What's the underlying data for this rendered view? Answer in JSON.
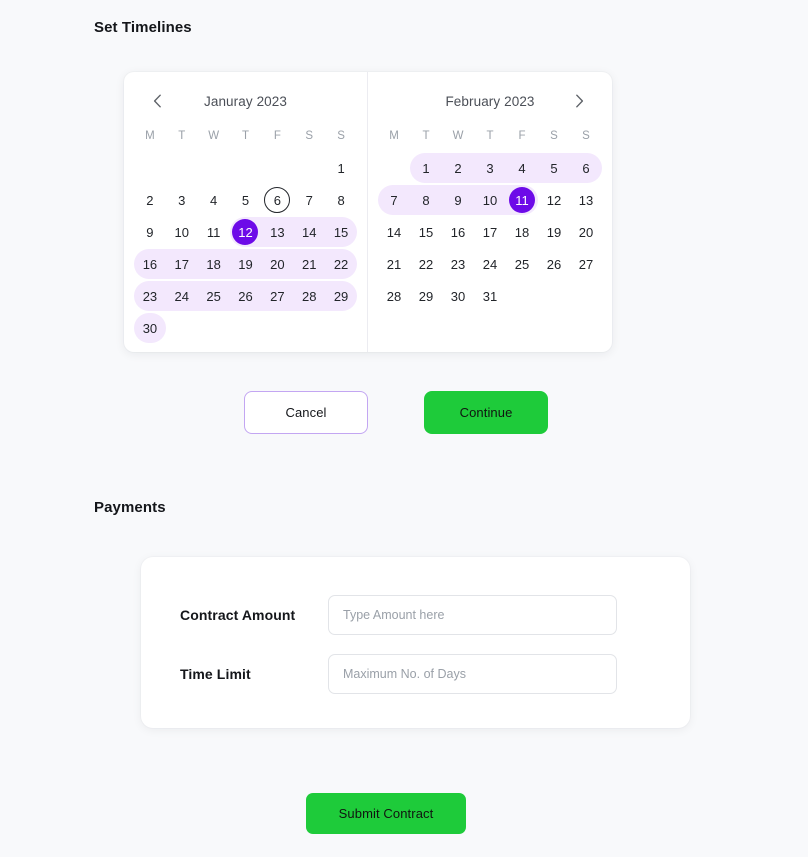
{
  "sections": {
    "timelines_title": "Set Timelines",
    "payments_title": "Payments"
  },
  "colors": {
    "page_background": "#f8f9fb",
    "card_background": "#ffffff",
    "selected_day": "#6d0ae8",
    "range_highlight": "#f3e8fd",
    "primary_green": "#1ecb3a",
    "cancel_border": "#c3a6f2",
    "muted_text": "#9aa0a8"
  },
  "calendar": {
    "prev_icon": "chevron-left-icon",
    "next_icon": "chevron-right-icon",
    "weekday_labels": [
      "M",
      "T",
      "W",
      "T",
      "F",
      "S",
      "S"
    ],
    "months": [
      {
        "title": "Januray 2023",
        "weeks": [
          [
            null,
            null,
            null,
            null,
            null,
            null,
            1
          ],
          [
            2,
            3,
            4,
            5,
            6,
            7,
            8
          ],
          [
            9,
            10,
            11,
            12,
            13,
            14,
            15
          ],
          [
            16,
            17,
            18,
            19,
            20,
            21,
            22
          ],
          [
            23,
            24,
            25,
            26,
            27,
            28,
            29
          ],
          [
            30,
            null,
            null,
            null,
            null,
            null,
            null
          ]
        ],
        "today": 6,
        "selected": 12,
        "range_rows": [
          {
            "week": 2,
            "start": 3,
            "end": 6,
            "round_left": true,
            "round_right": true
          },
          {
            "week": 3,
            "start": 0,
            "end": 6,
            "round_left": true,
            "round_right": true
          },
          {
            "week": 4,
            "start": 0,
            "end": 6,
            "round_left": true,
            "round_right": true
          },
          {
            "week": 5,
            "start": 0,
            "end": 0,
            "round_left": true,
            "round_right": true
          }
        ]
      },
      {
        "title": "February 2023",
        "weeks": [
          [
            null,
            1,
            2,
            3,
            4,
            5,
            6
          ],
          [
            7,
            8,
            9,
            10,
            11,
            12,
            13
          ],
          [
            14,
            15,
            16,
            17,
            18,
            19,
            20
          ],
          [
            21,
            22,
            23,
            24,
            25,
            26,
            27
          ],
          [
            28,
            29,
            30,
            31,
            null,
            null,
            null
          ]
        ],
        "today": null,
        "selected": 11,
        "range_rows": [
          {
            "week": 0,
            "start": 1,
            "end": 6,
            "round_left": true,
            "round_right": true
          },
          {
            "week": 1,
            "start": 0,
            "end": 4,
            "round_left": true,
            "round_right": true
          }
        ]
      }
    ]
  },
  "actions": {
    "cancel_label": "Cancel",
    "continue_label": "Continue",
    "submit_label": "Submit Contract"
  },
  "payments": {
    "fields": [
      {
        "label": "Contract Amount",
        "value": "",
        "placeholder": "Type Amount here"
      },
      {
        "label": "Time Limit",
        "value": "",
        "placeholder": "Maximum No. of Days"
      }
    ]
  }
}
